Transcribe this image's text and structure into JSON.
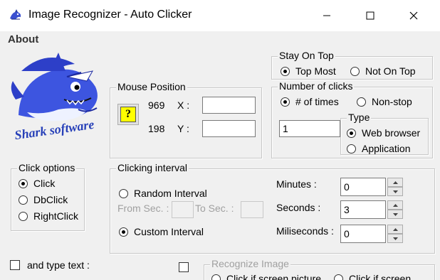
{
  "window": {
    "title": "Image Recognizer - Auto Clicker",
    "minimize_icon": "minimize-icon",
    "maximize_icon": "maximize-icon",
    "close_icon": "close-icon"
  },
  "menu": {
    "items": [
      "About"
    ]
  },
  "logo": {
    "text": "Shark software"
  },
  "stay_on_top": {
    "title": "Stay On Top",
    "options": [
      "Top Most",
      "Not On Top"
    ],
    "selected": "Top Most"
  },
  "mouse_position": {
    "title": "Mouse Position",
    "help_label": "?",
    "x_value": "969",
    "x_label": "X :",
    "y_value": "198",
    "y_label": "Y :",
    "x_field": "",
    "y_field": ""
  },
  "number_of_clicks": {
    "title": "Number of clicks",
    "options": [
      "# of times",
      "Non-stop"
    ],
    "selected": "# of times",
    "count": "1"
  },
  "type": {
    "title": "Type",
    "options": [
      "Web browser",
      "Application"
    ],
    "selected": "Web browser"
  },
  "click_options": {
    "title": "Click options",
    "options": [
      "Click",
      "DbClick",
      "RightClick"
    ],
    "selected": "Click"
  },
  "clicking_interval": {
    "title": "Clicking interval",
    "random_label": "Random Interval",
    "from_label": "From Sec. :",
    "to_label": "To Sec. :",
    "from_value": "",
    "to_value": "",
    "custom_label": "Custom Interval",
    "selected": "Custom Interval",
    "minutes_label": "Minutes :",
    "minutes_value": "0",
    "seconds_label": "Seconds :",
    "seconds_value": "3",
    "milliseconds_label": "Miliseconds :",
    "milliseconds_value": "0"
  },
  "type_text": {
    "label": "and type text :",
    "checked": false
  },
  "recognize_image": {
    "title": "Recognize Image",
    "checked": false,
    "option1": "Click if screen picture",
    "option2": "Click if screen"
  },
  "colors": {
    "background": "#f0f0f0",
    "titlebar": "#ffffff",
    "help_button": "#ffff00",
    "disabled_text": "#a0a0a0"
  }
}
